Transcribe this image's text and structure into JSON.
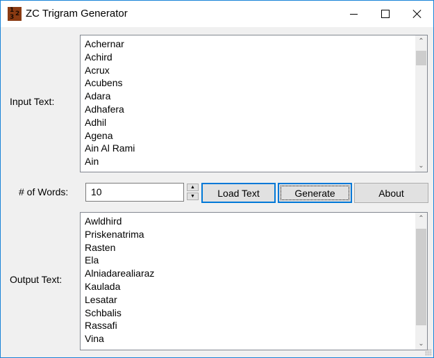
{
  "window": {
    "title": "ZC Trigram Generator",
    "icon": "trigram-app-icon",
    "controls": {
      "minimize": "minimize-icon",
      "maximize": "maximize-icon",
      "close": "close-icon"
    }
  },
  "input": {
    "label": "Input Text:",
    "items": [
      "Achernar",
      "Achird",
      "Acrux",
      "Acubens",
      "Adara",
      "Adhafera",
      "Adhil",
      "Agena",
      "Ain Al Rami",
      "Ain"
    ]
  },
  "controls": {
    "words_label": "# of Words:",
    "words_value": "10",
    "spin_up": "▲",
    "spin_down": "▼",
    "load_label": "Load Text",
    "generate_label": "Generate",
    "about_label": "About"
  },
  "output": {
    "label": "Output Text:",
    "items": [
      "Awldhird",
      "Priskenatrima",
      "Rasten",
      "Ela",
      "Alniadarealiaraz",
      "Kaulada",
      "Lesatar",
      "Schbalis",
      "Rassafi",
      "Vina"
    ]
  },
  "scrollbar": {
    "up_glyph": "⌃",
    "down_glyph": "⌄"
  },
  "colors": {
    "accent": "#0078d7",
    "window_border": "#1883d7",
    "background": "#f0f0f0"
  }
}
